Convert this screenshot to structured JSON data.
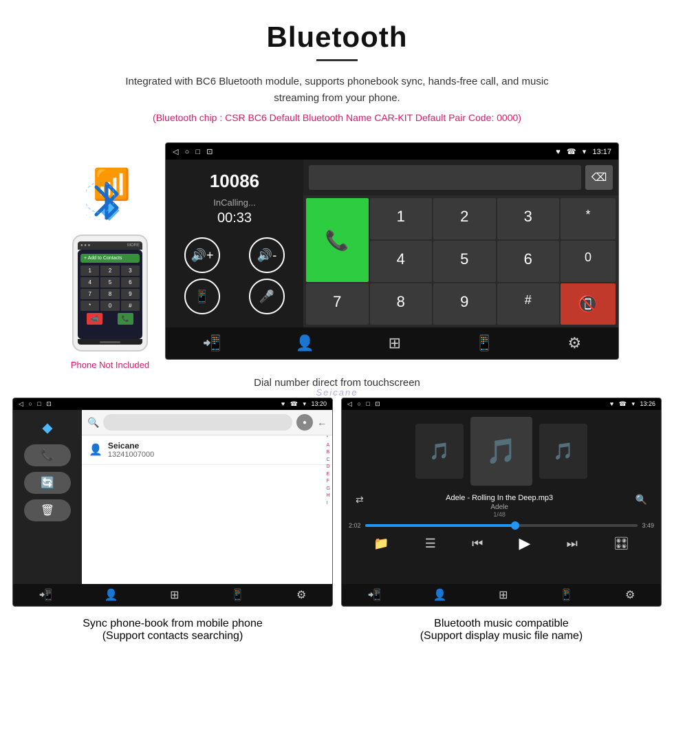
{
  "header": {
    "title": "Bluetooth",
    "description": "Integrated with BC6 Bluetooth module, supports phonebook sync, hands-free call, and music streaming from your phone.",
    "specs": "(Bluetooth chip : CSR BC6    Default Bluetooth Name CAR-KIT    Default Pair Code: 0000)"
  },
  "phone_sidebar": {
    "not_included": "Phone Not Included"
  },
  "dial_screen": {
    "statusbar": {
      "left_icons": "◁  ○  □  ⊡",
      "right_icons": "♥ ☏ ▾ 13:17"
    },
    "caller_number": "10086",
    "calling_status": "InCalling...",
    "call_timer": "00:33",
    "numpad_keys": [
      "1",
      "2",
      "3",
      "*",
      "4",
      "5",
      "6",
      "0",
      "7",
      "8",
      "9",
      "#"
    ],
    "green_btn": "📞",
    "red_btn": "📵"
  },
  "caption_dial": "Dial number direct from touchscreen",
  "phonebook_screen": {
    "statusbar_right": "♥ ☏ ▾ 13:20",
    "statusbar_left": "◁  ○  □  ⊡",
    "contact_name": "Seicane",
    "contact_number": "13241007000",
    "alphabet": [
      "*",
      "A",
      "B",
      "C",
      "D",
      "E",
      "F",
      "G",
      "H",
      "I"
    ]
  },
  "music_screen": {
    "statusbar_right": "♥ ☏ ▾ 13:26",
    "statusbar_left": "◁  ○  □  ⊡",
    "track_title": "Adele - Rolling In the Deep.mp3",
    "artist": "Adele",
    "track_num": "1/48",
    "time_current": "2:02",
    "time_total": "3:49",
    "progress_pct": 55
  },
  "caption_phonebook": {
    "line1": "Sync phone-book from mobile phone",
    "line2": "(Support contacts searching)"
  },
  "caption_music": {
    "line1": "Bluetooth music compatible",
    "line2": "(Support display music file name)"
  },
  "navbar_icons": {
    "call_transfer": "📲",
    "contacts": "👤",
    "dialpad": "⊞",
    "phone_menu": "📱",
    "settings": "⚙"
  }
}
